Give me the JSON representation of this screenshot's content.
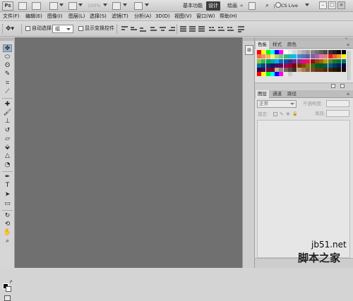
{
  "appbar": {
    "logo": "Ps",
    "zoom": "100%",
    "workspaces": [
      "基本功能",
      "设计",
      "绘画"
    ],
    "cs_live": "CS Live"
  },
  "menubar": {
    "items": [
      "文件(F)",
      "编辑(E)",
      "图像(I)",
      "图层(L)",
      "选择(S)",
      "滤镜(T)",
      "分析(A)",
      "3D(D)",
      "视图(V)",
      "窗口(W)",
      "帮助(H)"
    ]
  },
  "options": {
    "auto_select_label": "自动选择:",
    "auto_select_value": "组",
    "show_transform_label": "显示变换控件"
  },
  "panels": {
    "swatches_tabs": [
      "色板",
      "样式",
      "颜色"
    ],
    "layers_tabs": [
      "图层",
      "通道",
      "路径"
    ],
    "blend_mode": "正常",
    "opacity_label": "不透明度:",
    "lock_label": "锁定:",
    "fill_label": "填充:"
  },
  "watermark": {
    "url": "jb51.net",
    "site": "脚本之家"
  },
  "colors": {
    "canvas": "#707070",
    "panel": "#d6d6d6",
    "selected_tool": "#9fb1c9"
  }
}
